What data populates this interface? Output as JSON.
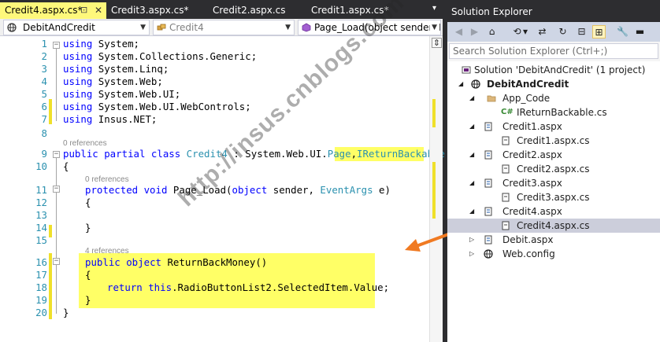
{
  "tabs": [
    {
      "label": "Credit4.aspx.cs*",
      "active": true
    },
    {
      "label": "Credit3.aspx.cs*",
      "active": false
    },
    {
      "label": "Credit2.aspx.cs",
      "active": false
    },
    {
      "label": "Credit1.aspx.cs*",
      "active": false
    }
  ],
  "tab_pin_glyph": "⊡",
  "tab_close_glyph": "✕",
  "tabs_dropdown_glyph": "▾",
  "navbar": {
    "project": "DebitAndCredit",
    "class": "Credit4",
    "member": "Page_Load(object sender, EventArgs e)"
  },
  "refs": {
    "line9": "0 references",
    "line11": "0 references",
    "line16": "4 references"
  },
  "code_lines": [
    {
      "n": "1"
    },
    {
      "n": "2"
    },
    {
      "n": "3"
    },
    {
      "n": "4"
    },
    {
      "n": "5"
    },
    {
      "n": "6"
    },
    {
      "n": "7"
    },
    {
      "n": "8"
    },
    {
      "n": "9"
    },
    {
      "n": "10"
    },
    {
      "n": "11"
    },
    {
      "n": "12"
    },
    {
      "n": "13"
    },
    {
      "n": "14"
    },
    {
      "n": "15"
    },
    {
      "n": "16"
    },
    {
      "n": "17"
    },
    {
      "n": "18"
    },
    {
      "n": "19"
    },
    {
      "n": "20"
    }
  ],
  "code": {
    "l1_kw": "using",
    "l1_rest": " System;",
    "l2_kw": "using",
    "l2_rest": " System.Collections.Generic;",
    "l3_kw": "using",
    "l3_rest": " System.Linq;",
    "l4_kw": "using",
    "l4_rest": " System.Web;",
    "l5_kw": "using",
    "l5_rest": " System.Web.UI;",
    "l6_kw": "using",
    "l6_rest": " System.Web.UI.WebControls;",
    "l7_kw": "using",
    "l7_rest": " Insus.NET;",
    "l9_kw1": "public",
    "l9_kw2": " partial",
    "l9_kw3": " class",
    "l9_type": " Credit4",
    "l9_mid": " : System.Web.UI.",
    "l9_page": "Page",
    "l9_comma": ",",
    "l9_iface": "IReturnBackable",
    "l10": "{",
    "l11_kw1": "protected",
    "l11_kw2": " void",
    "l11_name": " Page_Load(",
    "l11_kw3": "object",
    "l11_sender": " sender, ",
    "l11_type": "EventArgs",
    "l11_end": " e)",
    "l12": "{",
    "l14": "}",
    "l16_kw1": "public",
    "l16_kw2": " object",
    "l16_rest": " ReturnBackMoney()",
    "l17": "{",
    "l18_kw1": "return",
    "l18_kw2": " this",
    "l18_rest": ".RadioButtonList2.SelectedItem.Value;",
    "l19": "}",
    "l20": "}"
  },
  "watermark": "http://insus.cnblogs.com",
  "solution_explorer": {
    "title": "Solution Explorer",
    "search_placeholder": "Search Solution Explorer (Ctrl+;)",
    "toolbar": {
      "back": "◀",
      "forward": "▶",
      "home": "⌂",
      "history": "⟲",
      "history_arrow": "▾",
      "sync": "⇄",
      "refresh": "↻",
      "collapse": "⊟",
      "show_all": "⊞",
      "properties": "🔧",
      "pin": "▬"
    },
    "tree": [
      {
        "label": "Solution 'DebitAndCredit' (1 project)",
        "level": 0,
        "expander": "",
        "icon": "solution-icon",
        "bold": false,
        "selected": false
      },
      {
        "label": "DebitAndCredit",
        "level": 1,
        "expander": "◢",
        "icon": "web-project-icon",
        "bold": true,
        "selected": false
      },
      {
        "label": "App_Code",
        "level": 2,
        "expander": "◢",
        "icon": "folder-icon",
        "bold": false,
        "selected": false
      },
      {
        "label": "IReturnBackable.cs",
        "level": 3,
        "expander": "",
        "icon": "csharp-file-icon",
        "bold": false,
        "selected": false
      },
      {
        "label": "Credit1.aspx",
        "level": 2,
        "expander": "◢",
        "icon": "aspx-page-icon",
        "bold": false,
        "selected": false
      },
      {
        "label": "Credit1.aspx.cs",
        "level": 3,
        "expander": "",
        "icon": "code-file-icon",
        "bold": false,
        "selected": false
      },
      {
        "label": "Credit2.aspx",
        "level": 2,
        "expander": "◢",
        "icon": "aspx-page-icon",
        "bold": false,
        "selected": false
      },
      {
        "label": "Credit2.aspx.cs",
        "level": 3,
        "expander": "",
        "icon": "code-file-icon",
        "bold": false,
        "selected": false
      },
      {
        "label": "Credit3.aspx",
        "level": 2,
        "expander": "◢",
        "icon": "aspx-page-icon",
        "bold": false,
        "selected": false
      },
      {
        "label": "Credit3.aspx.cs",
        "level": 3,
        "expander": "",
        "icon": "code-file-icon",
        "bold": false,
        "selected": false
      },
      {
        "label": "Credit4.aspx",
        "level": 2,
        "expander": "◢",
        "icon": "aspx-page-icon",
        "bold": false,
        "selected": false
      },
      {
        "label": "Credit4.aspx.cs",
        "level": 3,
        "expander": "",
        "icon": "code-file-icon",
        "bold": false,
        "selected": true
      },
      {
        "label": "Debit.aspx",
        "level": 2,
        "expander": "▷",
        "icon": "aspx-page-icon",
        "bold": false,
        "selected": false
      },
      {
        "label": "Web.config",
        "level": 2,
        "expander": "▷",
        "icon": "config-file-icon",
        "bold": false,
        "selected": false
      }
    ]
  },
  "colors": {
    "keyword": "#0000ff",
    "type": "#2b91af",
    "highlight": "#ffff66",
    "change_marker": "#efe02a",
    "arrow": "#f07a22",
    "active_tab": "#fef87b"
  }
}
